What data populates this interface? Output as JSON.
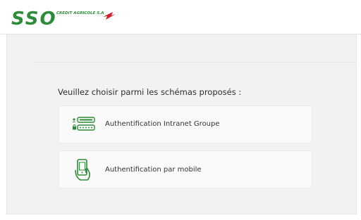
{
  "header": {
    "logo_text": "SSO",
    "logo_tagline": "CREDIT AGRICOLE S.A",
    "brand_colors": {
      "green": "#2e8b3a",
      "red": "#d2202a"
    }
  },
  "main": {
    "prompt": "Veuillez choisir parmi les schémas proposés :",
    "options": [
      {
        "label": "Authentification Intranet Groupe",
        "icon": "login-password-icon"
      },
      {
        "label": "Authentification par mobile",
        "icon": "mobile-hand-icon"
      }
    ]
  },
  "colors": {
    "icon_green": "#2e8b3a",
    "page_bg": "#f2f2f2",
    "option_bg": "#fafafa"
  }
}
